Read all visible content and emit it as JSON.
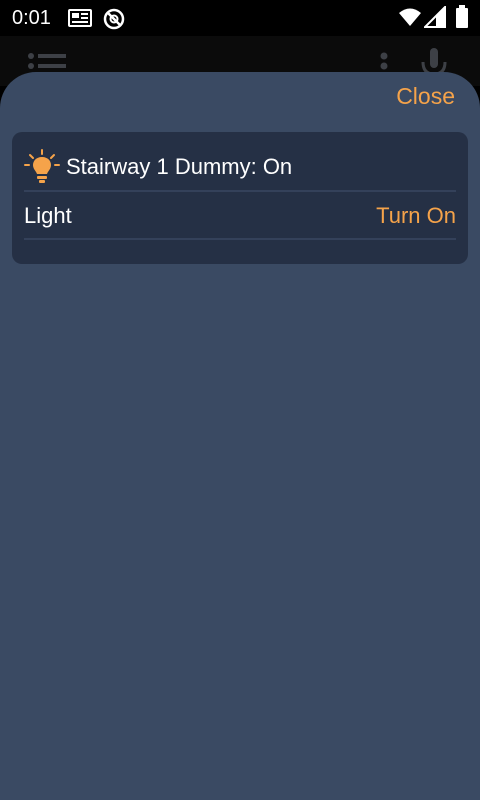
{
  "status_bar": {
    "time": "0:01",
    "icons": [
      "news-icon",
      "sync-off-icon",
      "wifi-icon",
      "signal-icon",
      "battery-icon"
    ]
  },
  "background": {
    "icons": [
      "menu-icon",
      "more-vert-icon",
      "microphone-icon"
    ]
  },
  "sheet": {
    "close_label": "Close",
    "card": {
      "icon": "lightbulb-icon",
      "title": "Stairway 1 Dummy: On",
      "row": {
        "label": "Light",
        "action": "Turn On"
      }
    }
  },
  "colors": {
    "accent": "#f5a34a",
    "sheet_bg": "#3a4a63",
    "card_bg": "#253045"
  }
}
